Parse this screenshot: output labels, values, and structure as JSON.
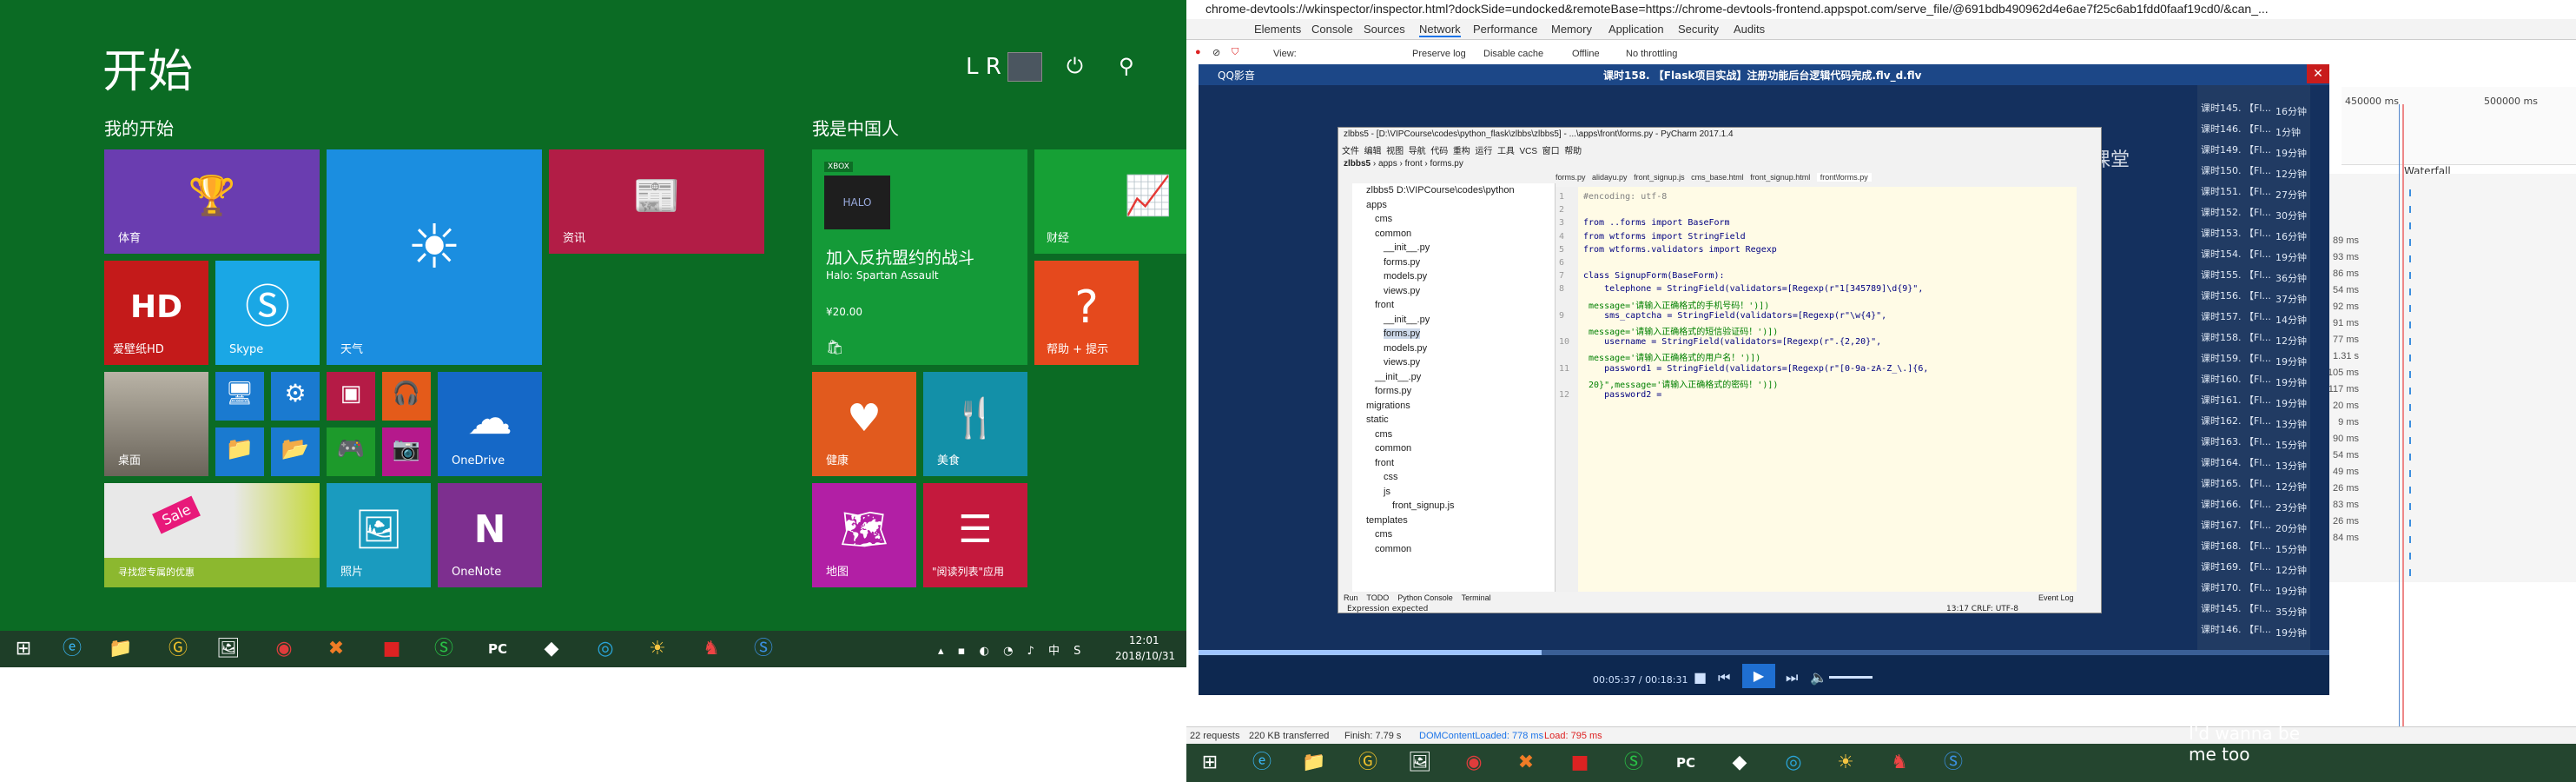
{
  "start": {
    "title": "开始",
    "user_initials": "L R",
    "groups": {
      "mine": "我的开始",
      "china": "我是中国人"
    },
    "tiles": {
      "sports": "体育",
      "weather": "天气",
      "news": "资讯",
      "hd": "爱壁纸HD",
      "skype": "Skype",
      "desktop": "桌面",
      "onedrive": "OneDrive",
      "deals": "寻找您专属的优惠",
      "photos": "照片",
      "onenote": "OneNote",
      "halo_title": "加入反抗盟约的战斗",
      "halo_sub": "Halo: Spartan Assault",
      "halo_price": "¥20.00",
      "halo_badge": "XBOX",
      "finance": "财经",
      "help": "帮助 + 提示",
      "health": "健康",
      "food": "美食",
      "maps": "地图",
      "reading": "\"阅读列表\"应用",
      "sale": "Sale"
    },
    "clock": {
      "time": "12:01",
      "date": "2018/10/31"
    }
  },
  "devtools": {
    "url": "chrome-devtools://wkinspector/inspector.html?dockSide=undocked&remoteBase=https://chrome-devtools-frontend.appspot.com/serve_file/@691bdb490962d4e6ae7f25c6ab1fdd0faaf19cd0/&can_...",
    "tabs": [
      "Elements",
      "Console",
      "Sources",
      "Network",
      "Performance",
      "Memory",
      "Application",
      "Security",
      "Audits"
    ],
    "active_tab": "Network",
    "toolbar": {
      "view": "View:",
      "preserve": "Preserve log",
      "disable_cache": "Disable cache",
      "offline": "Offline",
      "throttle": "No throttling"
    },
    "ticks": [
      "450000 ms",
      "500000 ms"
    ],
    "waterfall": "Waterfall",
    "rows": [
      {
        "name": "课时145. 【Fl...",
        "time": ""
      },
      {
        "name": "课时146. 【Fl...",
        "time": ""
      },
      {
        "name": "课时149. 【Fl...",
        "time": ""
      },
      {
        "name": "课时150. 【Fl...",
        "time": "89 ms"
      },
      {
        "name": "课时151. 【Fl...",
        "time": "93 ms"
      },
      {
        "name": "课时152. 【Fl...",
        "time": "86 ms"
      },
      {
        "name": "课时153. 【Fl...",
        "time": "54 ms"
      },
      {
        "name": "课时154. 【Fl...",
        "time": "92 ms"
      },
      {
        "name": "课时155. 【Fl...",
        "time": "91 ms"
      },
      {
        "name": "课时156. 【Fl...",
        "time": "77 ms"
      },
      {
        "name": "课时157. 【Fl...",
        "time": "1.31 s"
      },
      {
        "name": "课时158. 【Fl...",
        "time": "105 ms"
      },
      {
        "name": "课时159. 【Fl...",
        "time": "117 ms"
      },
      {
        "name": "课时160. 【Fl...",
        "time": "20 ms"
      },
      {
        "name": "课时161. 【Fl...",
        "time": "9 ms"
      },
      {
        "name": "课时162. 【Fl...",
        "time": "90 ms"
      },
      {
        "name": "课时163. 【Fl...",
        "time": "54 ms"
      },
      {
        "name": "课时164. 【Fl...",
        "time": "49 ms"
      },
      {
        "name": "课时165. 【Fl...",
        "time": "26 ms"
      },
      {
        "name": "课时166. 【Fl...",
        "time": "83 ms"
      },
      {
        "name": "课时167. 【Fl...",
        "time": "26 ms"
      },
      {
        "name": "课时168. 【Fl...",
        "time": "84 ms"
      },
      {
        "name": "课时169. 【Fl...",
        "time": ""
      },
      {
        "name": "课时170. 【Fl...",
        "time": ""
      }
    ],
    "durations": [
      "16分钟",
      "1分钟",
      "19分钟",
      "12分钟",
      "27分钟",
      "30分钟",
      "16分钟",
      "19分钟",
      "36分钟",
      "37分钟",
      "14分钟",
      "12分钟",
      "19分钟",
      "19分钟",
      "19分钟",
      "13分钟",
      "15分钟",
      "13分钟",
      "12分钟",
      "23分钟",
      "20分钟",
      "15分钟",
      "12分钟",
      "19分钟",
      "35分钟",
      "19分钟"
    ],
    "status": {
      "requests": "22 requests",
      "transferred": "220 KB transferred",
      "finish": "Finish: 7.79 s",
      "dcl": "DOMContentLoaded: 778 ms",
      "load": "Load: 795 ms"
    }
  },
  "player": {
    "app": "QQ影音",
    "title": "课时158. 【Flask项目实战】注册功能后台逻辑代码完成.flv_d.flv",
    "time": "00:05:37 / 00:18:31",
    "watermark": "网易云课堂",
    "lyric": "I'd wanna be me too"
  },
  "pycharm": {
    "title": "zlbbs5 - [D:\\VIPCourse\\codes\\python_flask\\zlbbs\\zlbbs5] - ...\\apps\\front\\forms.py - PyCharm 2017.1.4",
    "menu": [
      "文件",
      "编辑",
      "视图",
      "导航",
      "代码",
      "重构",
      "运行",
      "工具",
      "VCS",
      "窗口",
      "帮助"
    ],
    "crumbs": [
      "zlbbs5",
      "apps",
      "front",
      "forms.py"
    ],
    "editor_tabs": [
      "forms.py",
      "alidayu.py",
      "front_signup.js",
      "cms_base.html",
      "front_signup.html",
      "front\\forms.py"
    ],
    "tree": [
      "zlbbs5 D:\\VIPCourse\\codes\\python",
      "apps",
      "cms",
      "common",
      "__init__.py",
      "forms.py",
      "models.py",
      "views.py",
      "front",
      "__init__.py",
      "forms.py",
      "models.py",
      "views.py",
      "__init__.py",
      "forms.py",
      "migrations",
      "static",
      "cms",
      "common",
      "front",
      "css",
      "js",
      "front_signup.js",
      "templates",
      "cms",
      "common"
    ],
    "code": [
      "#encoding: utf-8",
      "",
      "from ..forms import BaseForm",
      "from wtforms import StringField",
      "from wtforms.validators import Regexp",
      "",
      "class SignupForm(BaseForm):",
      "    telephone = StringField(validators=[Regexp(r\"1[345789]\\d{9}\",",
      " message='请输入正确格式的手机号码！')])",
      "    sms_captcha = StringField(validators=[Regexp(r\"\\w{4}\",",
      " message='请输入正确格式的短信验证码！')])",
      "    username = StringField(validators=[Regexp(r\".{2,20}\",",
      " message='请输入正确格式的用户名！')])",
      "    password1 = StringField(validators=[Regexp(r\"[0-9a-zA-Z_\\.]{6,",
      " 20}\",message='请输入正确格式的密码！')])",
      "    password2 ="
    ],
    "line_numbers": [
      "1",
      "2",
      "3",
      "4",
      "5",
      "6",
      "7",
      "8",
      "",
      "9",
      "",
      "10",
      "",
      "11",
      "",
      "12"
    ],
    "bottom_tabs": [
      "Run",
      "TODO",
      "Python Console",
      "Terminal",
      "Event Log"
    ],
    "status": "Expression expected",
    "cursor": "13:17  CRLF: UTF-8"
  },
  "taskbar_icons": [
    "start-icon",
    "ie-icon",
    "explorer-icon",
    "g-icon",
    "picture-icon",
    "netease-music-icon",
    "xampp-icon",
    "box-icon",
    "s-icon",
    "pycharm-icon",
    "paint-icon",
    "qq-icon",
    "sun-icon",
    "bird-icon",
    "s2-icon"
  ]
}
